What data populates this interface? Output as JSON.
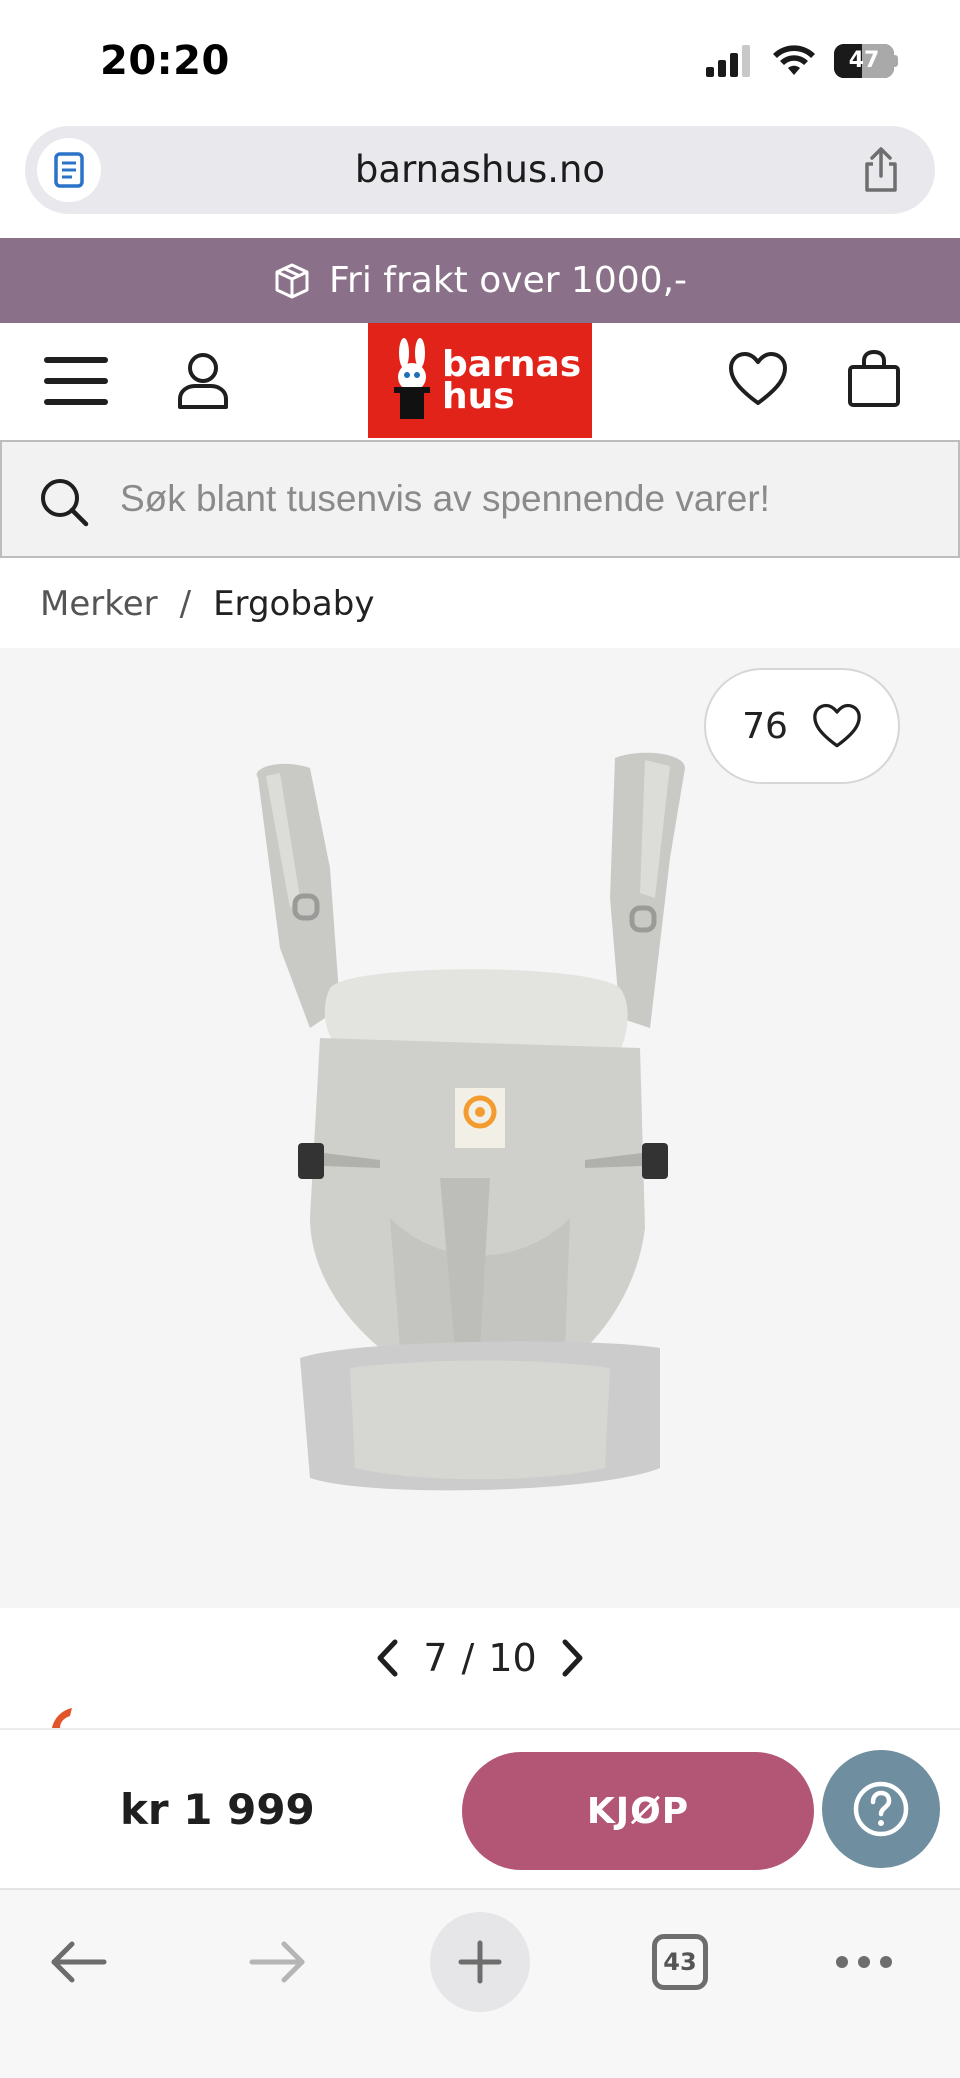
{
  "status_bar": {
    "time": "20:20",
    "battery": "47",
    "battery_fraction": 0.47
  },
  "browser": {
    "url": "barnashus.no",
    "open_tabs": "43"
  },
  "promo": {
    "text": "Fri frakt over 1000,-"
  },
  "header": {
    "logo_line1": "barnas",
    "logo_line2": "hus"
  },
  "search": {
    "placeholder": "Søk blant tusenvis av spennende varer!"
  },
  "breadcrumb": {
    "items": [
      "Merker",
      "Ergobaby"
    ],
    "separator": "/"
  },
  "gallery": {
    "likes": "76",
    "current": "7",
    "separator": "/",
    "total": "10"
  },
  "buy_bar": {
    "price": "kr 1 999",
    "buy_label": "KJØP"
  },
  "colors": {
    "promo_bg": "#8a7189",
    "logo_bg": "#e2231a",
    "buy_button": "#b35574",
    "help_button": "#6f8ea0"
  },
  "icons": {
    "reader": "reader-icon",
    "share": "share-icon",
    "package": "package-icon",
    "menu": "menu-icon",
    "account": "user-icon",
    "wishlist": "heart-icon",
    "cart": "bag-icon",
    "search": "search-icon",
    "help": "question-icon",
    "back": "arrow-left-icon",
    "forward": "arrow-right-icon",
    "new_tab": "plus-icon",
    "more": "ellipsis-icon"
  }
}
